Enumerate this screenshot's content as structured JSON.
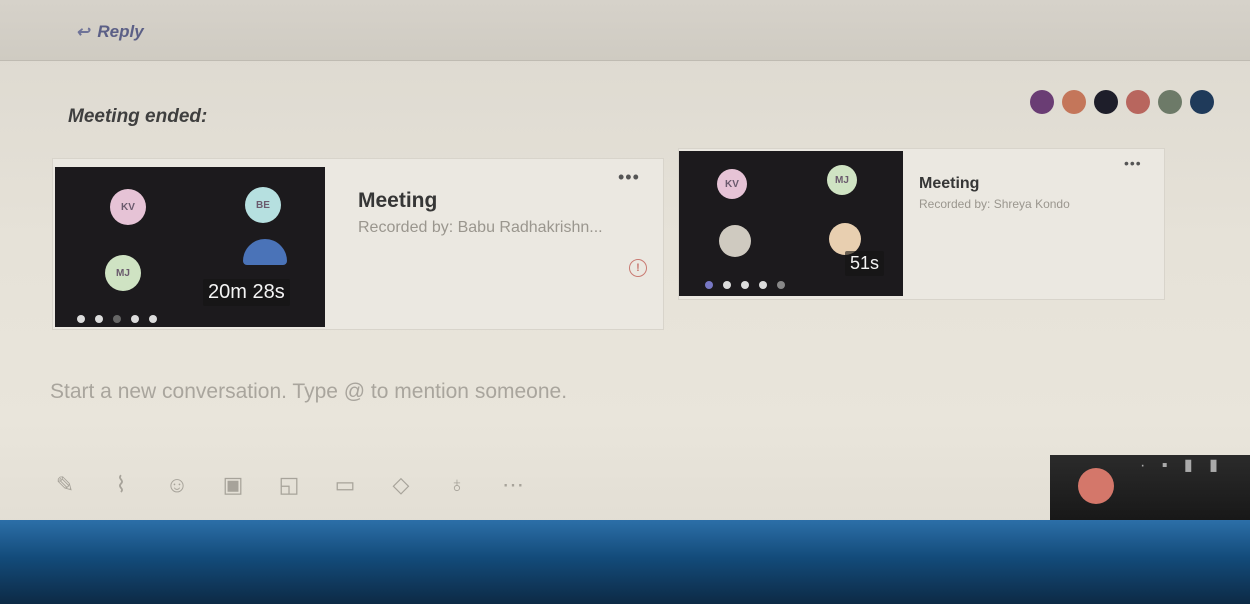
{
  "header": {
    "reply_label": "Reply"
  },
  "thread": {
    "title": "Meeting ended:",
    "participants": [
      "#6a3d74",
      "#c4765a",
      "#1e1e2a",
      "#b8665e",
      "#6d7a68",
      "#1f3a5a"
    ]
  },
  "recordings": [
    {
      "title": "Meeting",
      "recorded_by": "Recorded by: Babu Radhakrishn...",
      "duration": "20m 28s",
      "tiles": [
        {
          "initials": "KV",
          "color": "#e6c3d6"
        },
        {
          "initials": "BE",
          "color": "#b6e0e0"
        },
        {
          "initials": "MJ",
          "color": "#cfe3c3"
        }
      ]
    },
    {
      "title": "Meeting",
      "recorded_by": "Recorded by: Shreya Kondo",
      "duration": "51s",
      "tiles": [
        {
          "initials": "KV",
          "color": "#e6c3d6"
        },
        {
          "initials": "MJ",
          "color": "#cfe3c3"
        }
      ]
    }
  ],
  "composer": {
    "placeholder": "Start a new conversation. Type @ to mention someone."
  },
  "toolbar_icons": [
    "format-icon",
    "attach-icon",
    "emoji-icon",
    "gif-icon",
    "sticker-icon",
    "meet-now-icon",
    "praise-icon",
    "praise-lightbulb-icon",
    "more-options-icon"
  ]
}
